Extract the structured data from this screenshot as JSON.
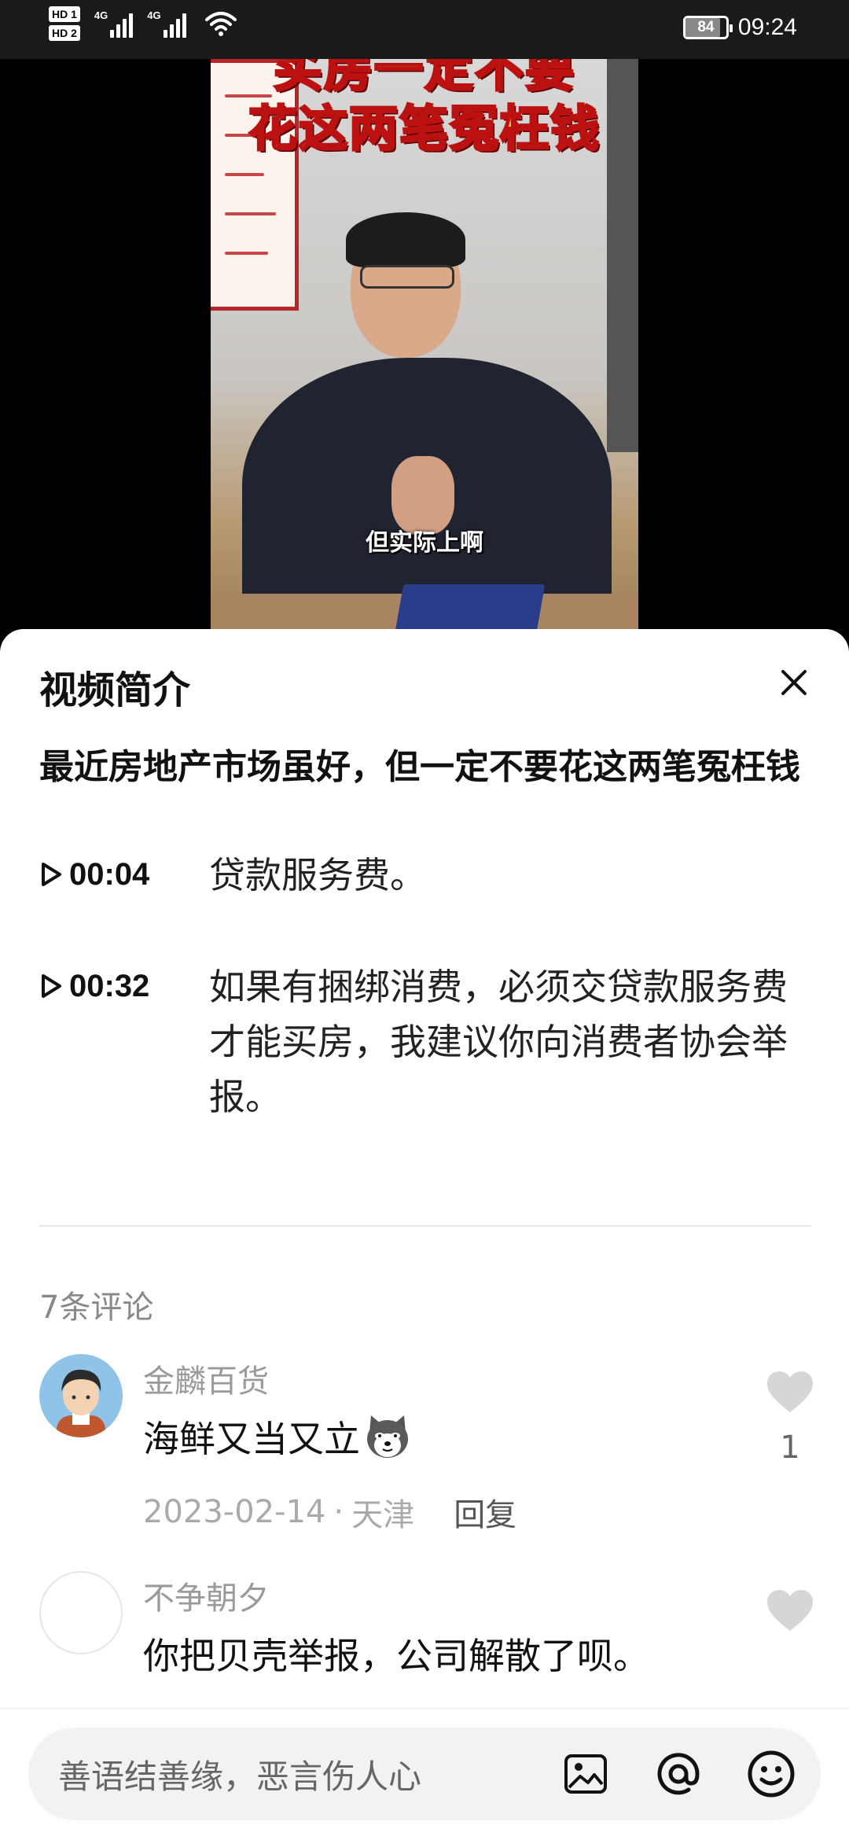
{
  "status_bar": {
    "hd1": "HD 1",
    "hd2": "HD 2",
    "net1": "4G",
    "net2": "4G",
    "battery": "84",
    "battery_level": 0.84,
    "time": "09:24"
  },
  "video": {
    "title_line1": "买房一定不要",
    "title_line2": "花这两笔冤枉钱",
    "subtitle": "但实际上啊"
  },
  "sheet": {
    "title": "视频简介",
    "description": "最近房地产市场虽好，但一定不要花这两笔冤枉钱",
    "chapters": [
      {
        "time": "00:04",
        "text": "贷款服务费。"
      },
      {
        "time": "00:32",
        "text": "如果有捆绑消费，必须交贷款服务费才能买房，我建议你向消费者协会举报。"
      }
    ],
    "comments_count": "7条评论",
    "comments": [
      {
        "user": "金麟百货",
        "text": "海鲜又当又立",
        "date": "2023-02-14",
        "location": "天津",
        "reply": "回复",
        "likes": "1"
      },
      {
        "user": "不争朝夕",
        "text": "你把贝壳举报，公司解散了呗。"
      }
    ],
    "separator": "·"
  },
  "input": {
    "placeholder": "善语结善缘，恶言伤人心"
  },
  "colors": {
    "accent_red": "#b8242a",
    "like_grey": "#d6d6d6"
  }
}
